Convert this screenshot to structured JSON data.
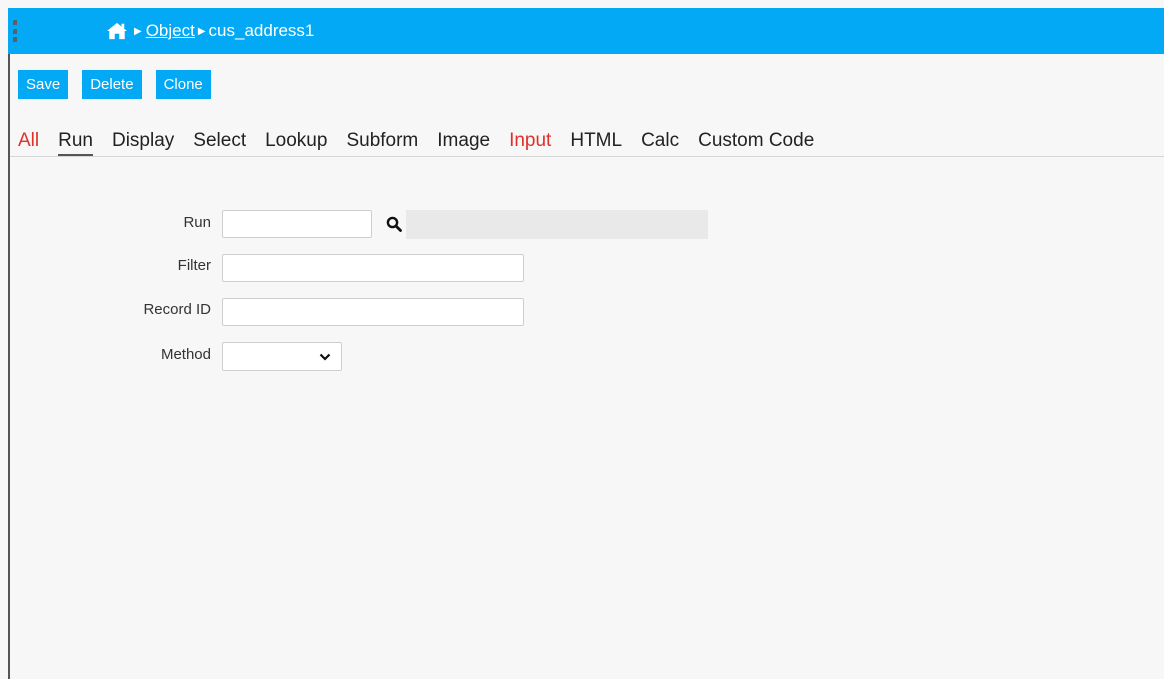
{
  "breadcrumb": {
    "home_icon": "home-icon",
    "object_link": "Object",
    "current": "cus_address1"
  },
  "toolbar": {
    "save_label": "Save",
    "delete_label": "Delete",
    "clone_label": "Clone"
  },
  "tabs": [
    {
      "label": "All",
      "highlight": true
    },
    {
      "label": "Run",
      "active": true
    },
    {
      "label": "Display"
    },
    {
      "label": "Select"
    },
    {
      "label": "Lookup"
    },
    {
      "label": "Subform"
    },
    {
      "label": "Image"
    },
    {
      "label": "Input",
      "highlight": true
    },
    {
      "label": "HTML"
    },
    {
      "label": "Calc"
    },
    {
      "label": "Custom Code"
    }
  ],
  "form": {
    "run": {
      "label": "Run",
      "value": "",
      "lookup_display": ""
    },
    "filter": {
      "label": "Filter",
      "value": ""
    },
    "record_id": {
      "label": "Record ID",
      "value": ""
    },
    "method": {
      "label": "Method",
      "value": ""
    }
  },
  "colors": {
    "topbar": "#03a9f4",
    "highlight_tab": "#e0302a",
    "background": "#f7f7f7"
  }
}
